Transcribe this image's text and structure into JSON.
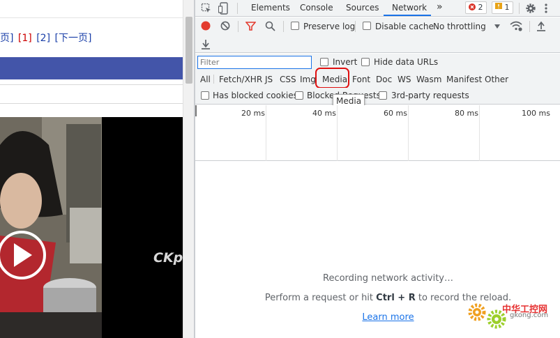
{
  "webpage": {
    "pagination": {
      "prev_fragment": "页]",
      "page1": "[1]",
      "page2": "[2]",
      "next": "[下一页]"
    },
    "video": {
      "watermark": "CKp"
    }
  },
  "devtools": {
    "tabs": [
      "Elements",
      "Console",
      "Sources",
      "Network"
    ],
    "active_tab": "Network",
    "more_tabs_glyph": "»",
    "errors_count": "2",
    "warnings_count": "1",
    "toolbar": {
      "preserve_log": "Preserve log",
      "disable_cache": "Disable cache",
      "throttling": "No throttling"
    },
    "filter": {
      "placeholder": "Filter",
      "invert": "Invert",
      "hide_data_urls": "Hide data URLs"
    },
    "types": [
      "All",
      "Fetch/XHR",
      "JS",
      "CSS",
      "Img",
      "Media",
      "Font",
      "Doc",
      "WS",
      "Wasm",
      "Manifest",
      "Other"
    ],
    "highlighted_type": "Media",
    "tooltip": "Media",
    "cookies": {
      "has_blocked_cookies": "Has blocked cookies",
      "blocked_requests": "Blocked Requests",
      "third_party": "3rd-party requests"
    },
    "timeline_ticks": [
      "20 ms",
      "40 ms",
      "60 ms",
      "80 ms",
      "100 ms"
    ],
    "empty_state": {
      "title": "Recording network activity…",
      "hint_before": "Perform a request or hit ",
      "hint_keys": "Ctrl + R",
      "hint_after": " to record the reload.",
      "learn_more": "Learn more"
    }
  },
  "watermark_logo": {
    "name": "中华工控网",
    "domain": "gkong.com"
  },
  "colors": {
    "accent": "#1a73e8",
    "record": "#e33b2e",
    "page_blue_bar": "#4355a9",
    "highlight_ring": "#e01010"
  }
}
